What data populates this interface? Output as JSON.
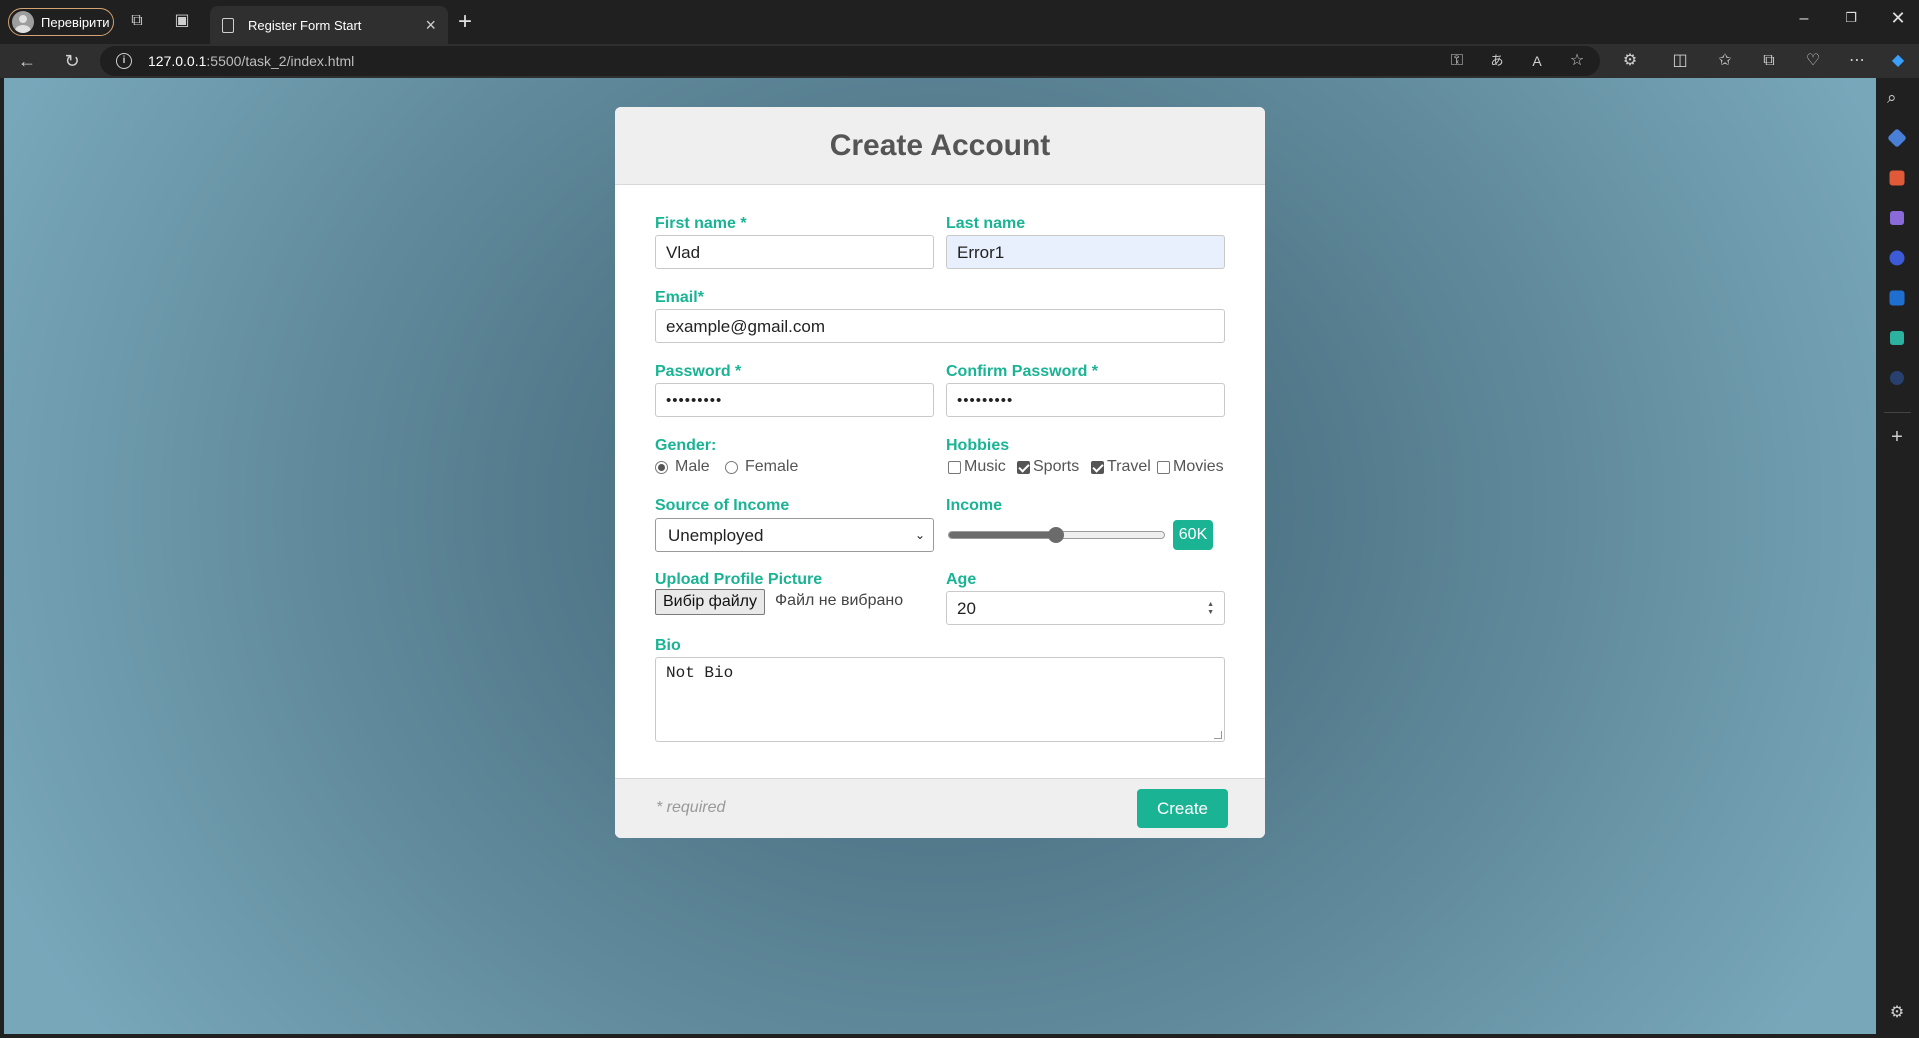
{
  "browser": {
    "profile_label": "Перевірити",
    "tab_title": "Register Form Start",
    "url_host": "127.0.0.1",
    "url_path": ":5500/task_2/index.html"
  },
  "form": {
    "title": "Create Account",
    "first_name": {
      "label": "First name *",
      "value": "Vlad"
    },
    "last_name": {
      "label": "Last name",
      "value": "Error1"
    },
    "email": {
      "label": "Email*",
      "value": "example@gmail.com"
    },
    "password": {
      "label": "Password *",
      "value": "•••••••••"
    },
    "confirm_password": {
      "label": "Confirm Password *",
      "value": "•••••••••"
    },
    "gender": {
      "label": "Gender:",
      "options": [
        "Male",
        "Female"
      ],
      "selected": "Male"
    },
    "hobbies": {
      "label": "Hobbies",
      "options": [
        "Music",
        "Sports",
        "Travel",
        "Movies"
      ],
      "checked": [
        "Sports",
        "Travel"
      ]
    },
    "source_of_income": {
      "label": "Source of Income",
      "selected": "Unemployed"
    },
    "income": {
      "label": "Income",
      "value_label": "60K",
      "fraction": 0.5
    },
    "upload": {
      "label": "Upload Profile Picture",
      "button_label": "Вибір файлу",
      "status": "Файл не вибрано"
    },
    "age": {
      "label": "Age",
      "value": "20"
    },
    "bio": {
      "label": "Bio",
      "value": "Not Bio"
    },
    "required_note": "* required",
    "submit_label": "Create"
  },
  "colors": {
    "accent": "#1ab394",
    "header_bg": "#efefef",
    "text_muted": "#555555"
  }
}
